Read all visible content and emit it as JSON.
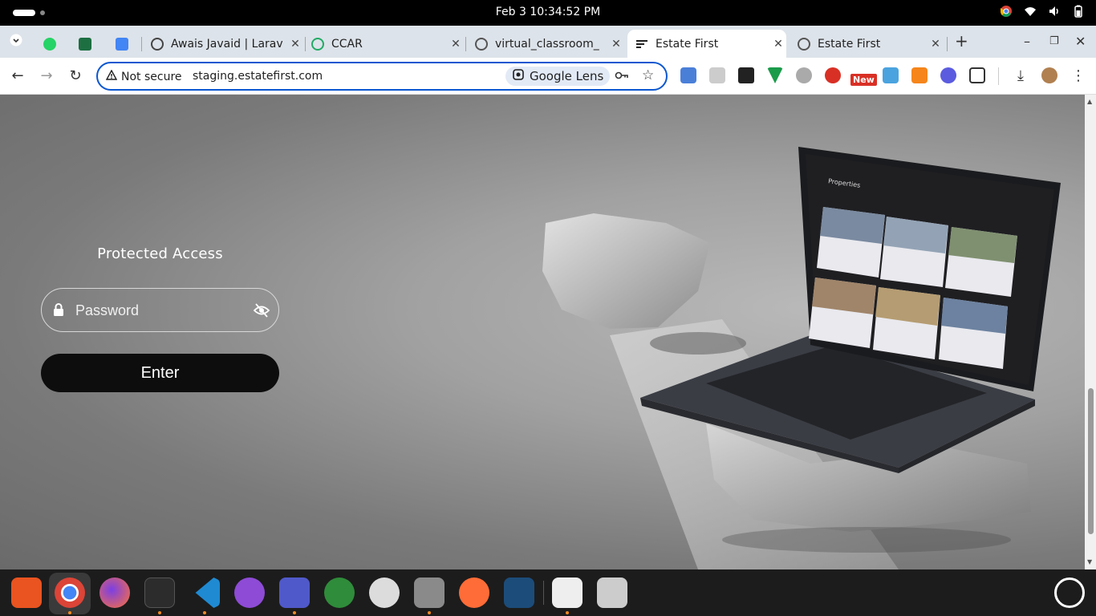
{
  "system_bar": {
    "datetime": "Feb 3  10:34:52 PM"
  },
  "tabs": [
    {
      "title": "",
      "icon": "whatsapp-icon",
      "active": false
    },
    {
      "title": "",
      "icon": "excel-icon",
      "active": false
    },
    {
      "title": "",
      "icon": "docs-icon",
      "active": false
    },
    {
      "title": "Awais Javaid | Larav",
      "icon": "globe-icon",
      "active": false
    },
    {
      "title": "CCAR",
      "icon": "ccar-icon",
      "active": false
    },
    {
      "title": "virtual_classroom_",
      "icon": "app-icon",
      "active": false
    },
    {
      "title": "Estate First",
      "icon": "estate-icon",
      "active": true
    },
    {
      "title": "Estate First",
      "icon": "app-icon",
      "active": false
    }
  ],
  "toolbar": {
    "security_label": "Not secure",
    "url": "staging.estatefirst.com",
    "lens_label": "Google Lens",
    "new_badge": "New"
  },
  "page": {
    "heading": "Protected Access",
    "password_placeholder": "Password",
    "enter_label": "Enter",
    "laptop_screen_title": "Properties"
  },
  "colors": {
    "accent": "#0b57d0",
    "button_bg": "#0d0d0d",
    "tabstrip_bg": "#dde3ea"
  }
}
